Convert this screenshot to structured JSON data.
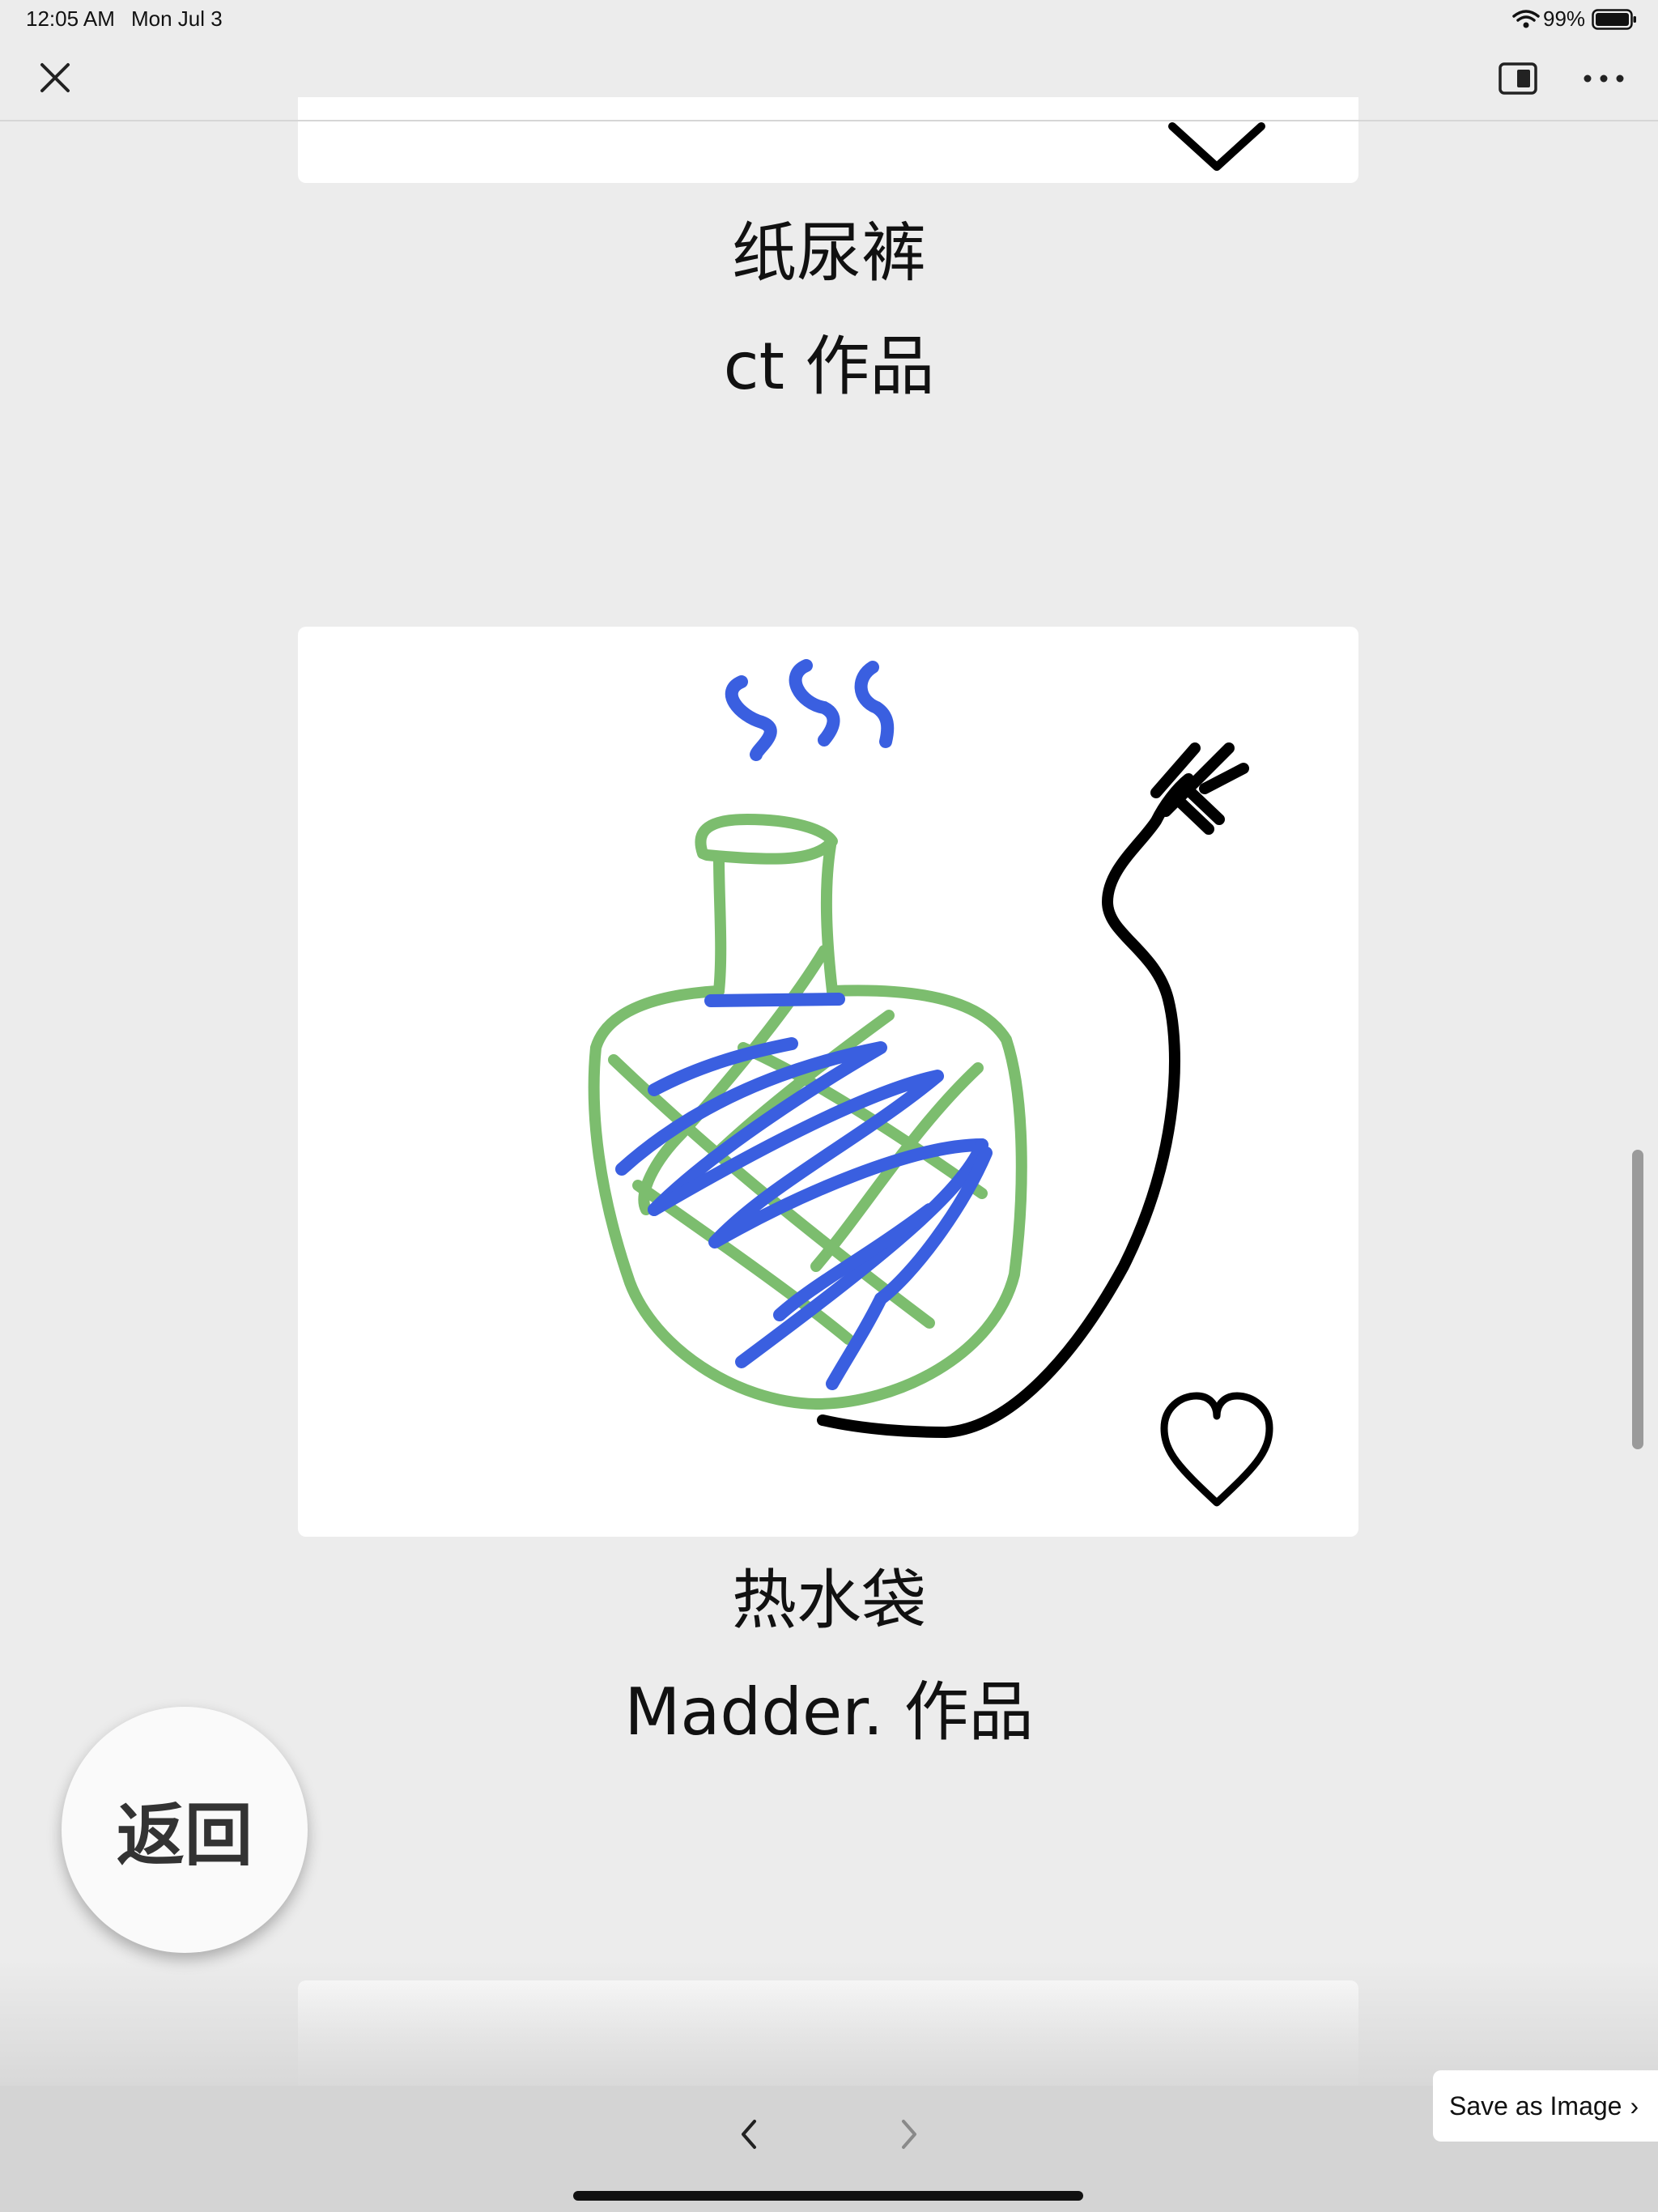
{
  "status_bar": {
    "time": "12:05 AM",
    "date": "Mon Jul 3",
    "battery": "99%"
  },
  "feed": {
    "items": [
      {
        "title": "纸尿裤",
        "author": "ct 作品"
      },
      {
        "title": "热水袋",
        "author": "Madder. 作品"
      }
    ]
  },
  "buttons": {
    "return_label": "返回",
    "save_label": "Save as Image",
    "save_chevron": "›"
  },
  "colors": {
    "sketch_blue": "#3a5fe0",
    "sketch_green": "#7cbd6e",
    "sketch_black": "#000000"
  }
}
